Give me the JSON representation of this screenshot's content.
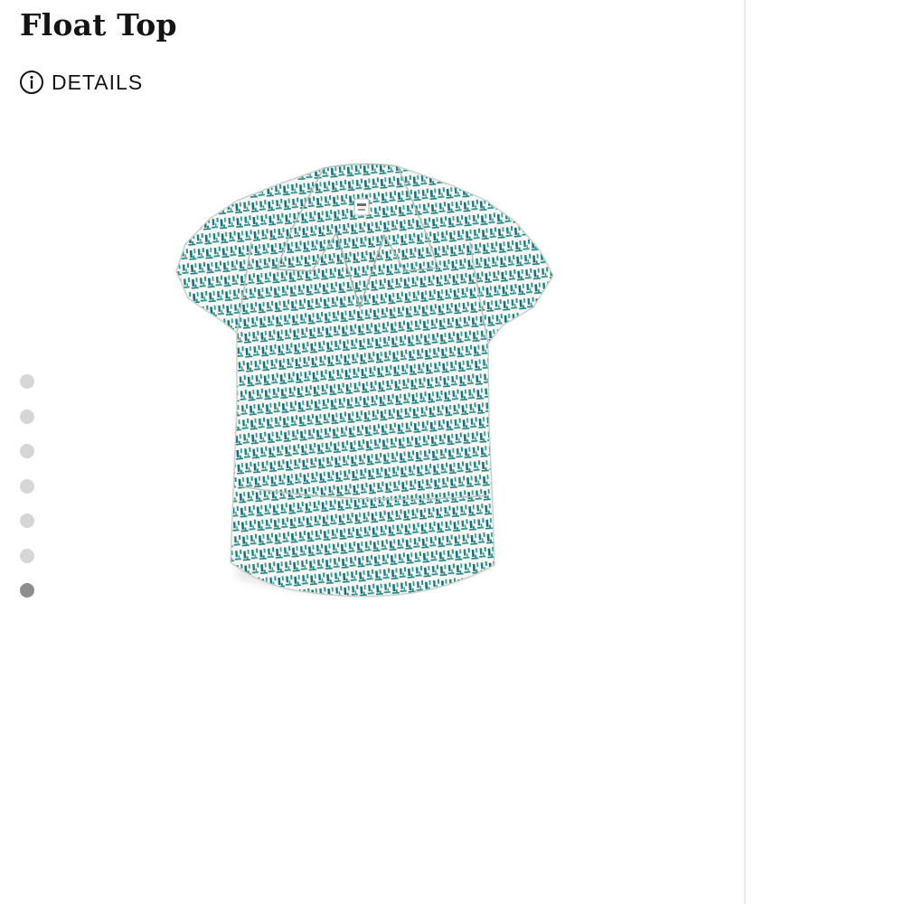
{
  "product": {
    "title": "Float Top",
    "details_label": "DETAILS",
    "details_icon": "info-circle-icon",
    "image_alt": "Short-sleeve collared top with teal crosshatch print"
  },
  "gallery": {
    "image_count": 7,
    "active_index": 6
  },
  "colors": {
    "text": "#141414",
    "dot_inactive": "#d6d6d6",
    "dot_active": "#8e8e8e",
    "print_teal": "#1d7f83",
    "fabric": "#f7f8f3",
    "divider": "#e8e8e8"
  }
}
